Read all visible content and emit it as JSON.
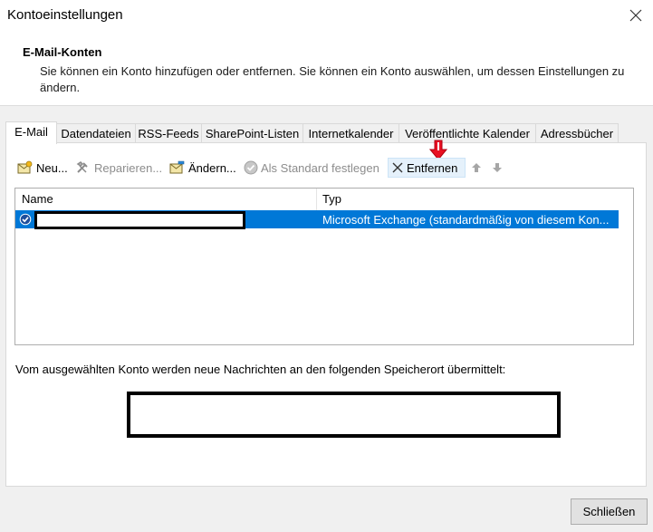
{
  "window": {
    "title": "Kontoeinstellungen"
  },
  "header": {
    "title": "E-Mail-Konten",
    "description": "Sie können ein Konto hinzufügen oder entfernen. Sie können ein Konto auswählen, um dessen Einstellungen zu ändern."
  },
  "tabs": [
    {
      "label": "E-Mail",
      "active": true
    },
    {
      "label": "Datendateien"
    },
    {
      "label": "RSS-Feeds"
    },
    {
      "label": "SharePoint-Listen"
    },
    {
      "label": "Internetkalender"
    },
    {
      "label": "Veröffentlichte Kalender"
    },
    {
      "label": "Adressbücher"
    }
  ],
  "toolbar": {
    "new": "Neu...",
    "repair": "Reparieren...",
    "change": "Ändern...",
    "set_default": "Als Standard festlegen",
    "remove": "Entfernen"
  },
  "accounts": {
    "columns": {
      "name": "Name",
      "type": "Typ"
    },
    "rows": [
      {
        "name": "",
        "type": "Microsoft Exchange (standardmäßig von diesem Kon..."
      }
    ]
  },
  "delivery": {
    "text": "Vom ausgewählten Konto werden neue Nachrichten an den folgenden Speicherort übermittelt:"
  },
  "footer": {
    "close": "Schließen"
  },
  "colors": {
    "selection": "#0078d7",
    "marker": "#e81123"
  }
}
